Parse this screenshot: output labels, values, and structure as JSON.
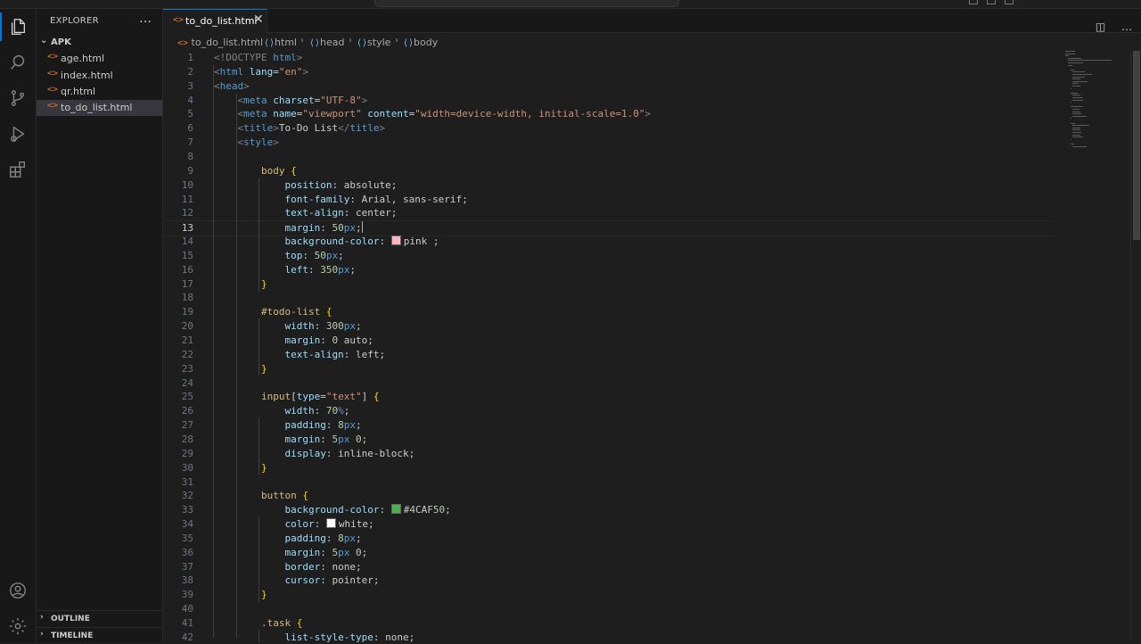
{
  "sidebar": {
    "title": "EXPLORER",
    "more_icon": "…",
    "folder": "APK",
    "files": [
      "age.html",
      "index.html",
      "qr.html",
      "to_do_list.html"
    ],
    "selected_file": "to_do_list.html",
    "sections": [
      "OUTLINE",
      "TIMELINE"
    ]
  },
  "tab": {
    "label": "to_do_list.html",
    "close": "✕"
  },
  "breadcrumbs": [
    "to_do_list.html",
    "html",
    "head",
    "style",
    "body"
  ],
  "editor": {
    "current_line": 13,
    "colors": {
      "pink": "#ffb6c1",
      "green": "#4CAF50",
      "white": "#ffffff"
    }
  },
  "code_lines": [
    {
      "n": "1",
      "t": "<!DOCTYPE html>"
    },
    {
      "n": "2",
      "t": "<html lang=\"en\">"
    },
    {
      "n": "3",
      "t": "<head>"
    },
    {
      "n": "4",
      "t": "    <meta charset=\"UTF-8\">"
    },
    {
      "n": "5",
      "t": "    <meta name=\"viewport\" content=\"width=device-width, initial-scale=1.0\">"
    },
    {
      "n": "6",
      "t": "    <title>To-Do List</title>"
    },
    {
      "n": "7",
      "t": "    <style>"
    },
    {
      "n": "8",
      "t": ""
    },
    {
      "n": "9",
      "t": "        body {"
    },
    {
      "n": "10",
      "t": "            position: absolute;"
    },
    {
      "n": "11",
      "t": "            font-family: Arial, sans-serif;"
    },
    {
      "n": "12",
      "t": "            text-align: center;"
    },
    {
      "n": "13",
      "t": "            margin: 50px;"
    },
    {
      "n": "14",
      "t": "            background-color: pink ;"
    },
    {
      "n": "15",
      "t": "            top: 50px;"
    },
    {
      "n": "16",
      "t": "            left: 350px;"
    },
    {
      "n": "17",
      "t": "        }"
    },
    {
      "n": "18",
      "t": ""
    },
    {
      "n": "19",
      "t": "        #todo-list {"
    },
    {
      "n": "20",
      "t": "            width: 300px;"
    },
    {
      "n": "21",
      "t": "            margin: 0 auto;"
    },
    {
      "n": "22",
      "t": "            text-align: left;"
    },
    {
      "n": "23",
      "t": "        }"
    },
    {
      "n": "24",
      "t": ""
    },
    {
      "n": "25",
      "t": "        input[type=\"text\"] {"
    },
    {
      "n": "26",
      "t": "            width: 70%;"
    },
    {
      "n": "27",
      "t": "            padding: 8px;"
    },
    {
      "n": "28",
      "t": "            margin: 5px 0;"
    },
    {
      "n": "29",
      "t": "            display: inline-block;"
    },
    {
      "n": "30",
      "t": "        }"
    },
    {
      "n": "31",
      "t": ""
    },
    {
      "n": "32",
      "t": "        button {"
    },
    {
      "n": "33",
      "t": "            background-color: #4CAF50;"
    },
    {
      "n": "34",
      "t": "            color: white;"
    },
    {
      "n": "35",
      "t": "            padding: 8px;"
    },
    {
      "n": "36",
      "t": "            margin: 5px 0;"
    },
    {
      "n": "37",
      "t": "            border: none;"
    },
    {
      "n": "38",
      "t": "            cursor: pointer;"
    },
    {
      "n": "39",
      "t": "        }"
    },
    {
      "n": "40",
      "t": ""
    },
    {
      "n": "41",
      "t": "        .task {"
    },
    {
      "n": "42",
      "t": "            list-style-type: none;"
    }
  ]
}
